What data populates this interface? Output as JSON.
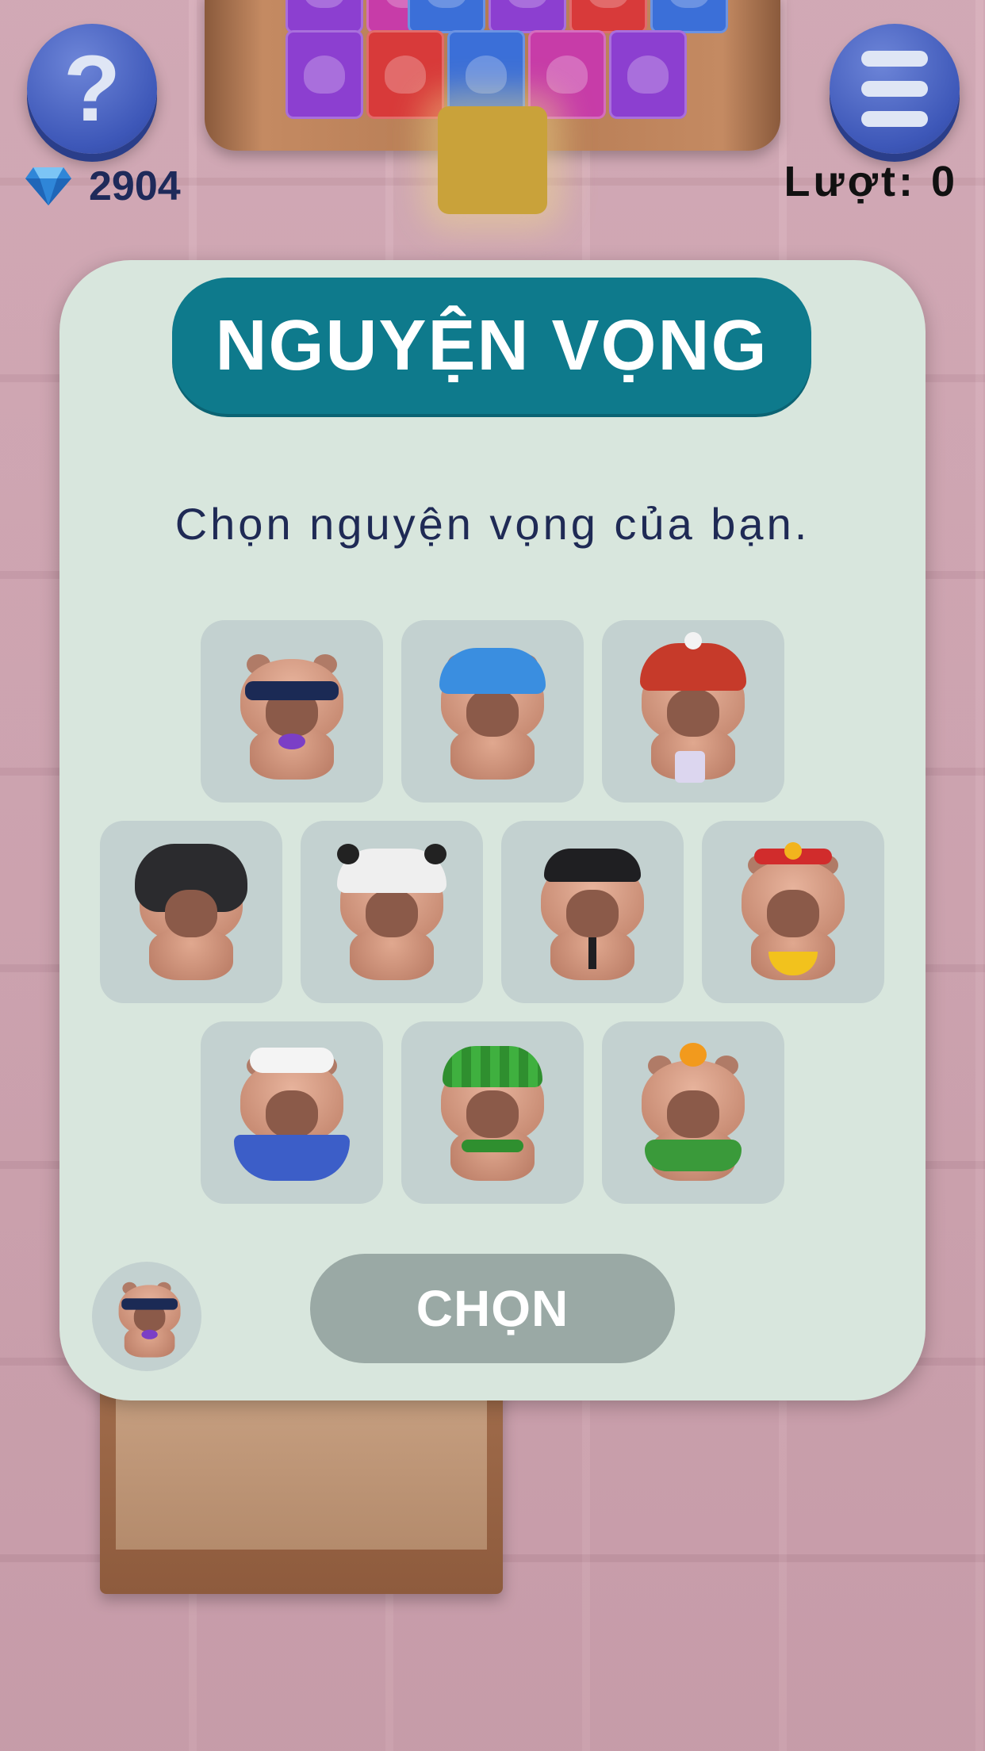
{
  "hud": {
    "gems": "2904",
    "turns": "Lượt: 0",
    "help_icon": "question-mark-icon",
    "menu_icon": "hamburger-menu-icon",
    "gem_icon": "diamond-icon"
  },
  "tray_cards": [
    {
      "color": "#8c3fd0"
    },
    {
      "color": "#d83a3a"
    },
    {
      "color": "#3b6fd8"
    },
    {
      "color": "#c73ca8"
    },
    {
      "color": "#8c3fd0"
    }
  ],
  "modal": {
    "title": "NGUYỆN VỌNG",
    "subtitle": "Chọn nguyện vọng của bạn.",
    "button": "CHỌN",
    "options": [
      {
        "id": "sunglasses",
        "accessory": "sunglasses"
      },
      {
        "id": "bandana",
        "accessory": "blue-bandana"
      },
      {
        "id": "winter-hat",
        "accessory": "red-beanie"
      },
      {
        "id": "bat-mask",
        "accessory": "black-mask"
      },
      {
        "id": "panda",
        "accessory": "panda-hood"
      },
      {
        "id": "black-cap",
        "accessory": "black-cap"
      },
      {
        "id": "lucky",
        "accessory": "red-crown"
      },
      {
        "id": "towel-bath",
        "accessory": "towel"
      },
      {
        "id": "watermelon",
        "accessory": "watermelon-hat"
      },
      {
        "id": "orange",
        "accessory": "orange-leaf"
      }
    ]
  },
  "colors": {
    "modal_bg": "#d8e6dd",
    "title_bg": "#0e7a8c",
    "button_disabled": "#9aa9a5",
    "slot_bg": "#c3d1d0"
  }
}
